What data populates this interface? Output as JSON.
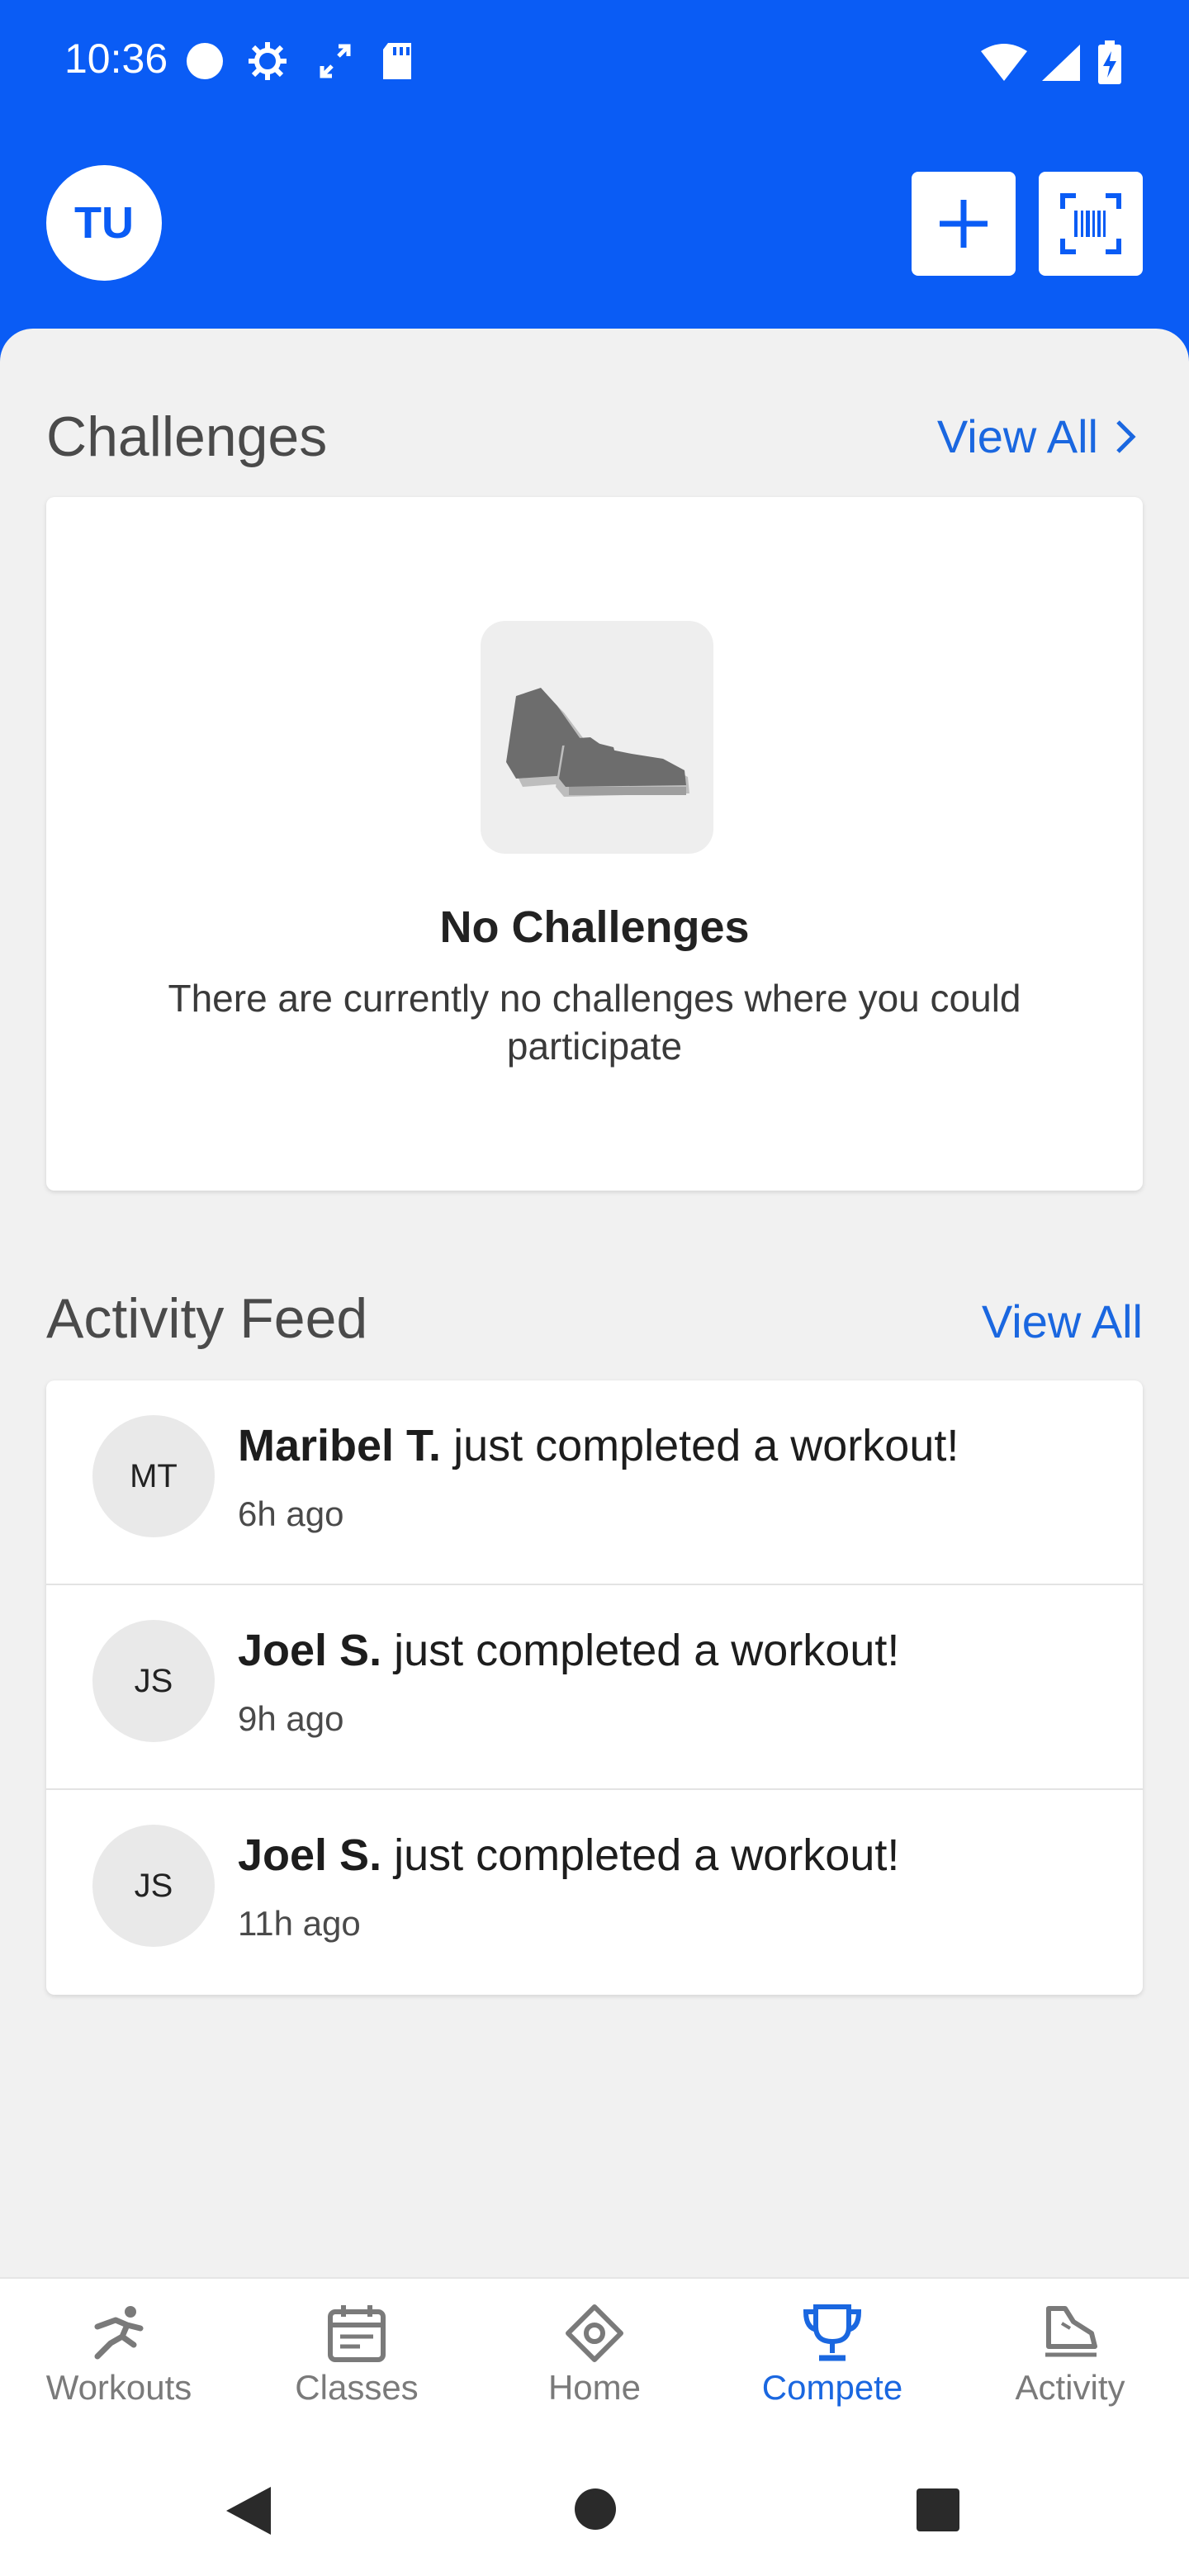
{
  "status_bar": {
    "time": "10:36"
  },
  "header": {
    "avatar_initials": "TU",
    "add_icon": "plus-icon",
    "scan_icon": "barcode-scan-icon"
  },
  "challenges": {
    "title": "Challenges",
    "view_all": "View All",
    "empty_title": "No Challenges",
    "empty_desc": "There are currently no challenges where you could participate"
  },
  "activity_feed": {
    "title": "Activity Feed",
    "view_all": "View All",
    "items": [
      {
        "initials": "MT",
        "name": "Maribel T.",
        "action": " just completed a workout!",
        "time": "6h ago"
      },
      {
        "initials": "JS",
        "name": "Joel S.",
        "action": " just completed a workout!",
        "time": "9h ago"
      },
      {
        "initials": "JS",
        "name": "Joel S.",
        "action": " just completed a workout!",
        "time": "11h ago"
      }
    ]
  },
  "bottom_nav": [
    {
      "label": "Workouts",
      "icon": "running-person-icon"
    },
    {
      "label": "Classes",
      "icon": "calendar-icon"
    },
    {
      "label": "Home",
      "icon": "home-diamond-icon"
    },
    {
      "label": "Compete",
      "icon": "trophy-icon",
      "active": true
    },
    {
      "label": "Activity",
      "icon": "shoe-icon"
    }
  ],
  "colors": {
    "primary": "#0a5cf5",
    "link": "#1a67e0",
    "background": "#f1f1f1"
  }
}
